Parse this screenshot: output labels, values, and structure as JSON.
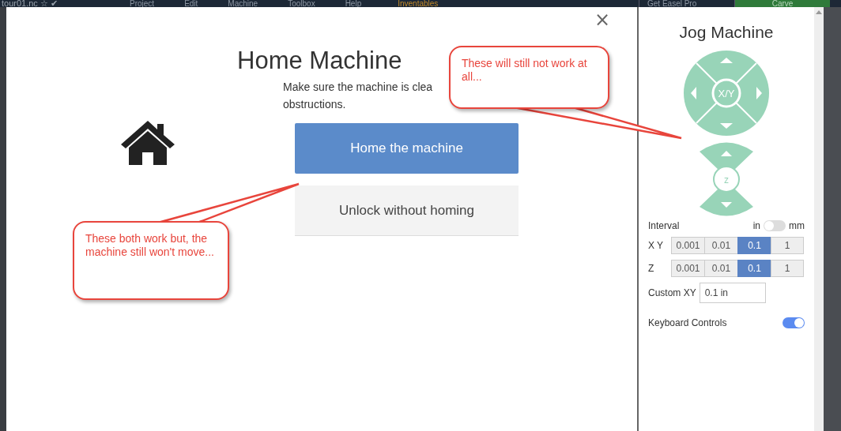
{
  "top_bar": {
    "file_name": "tour01.nc ☆ ✔",
    "menu": [
      "Project",
      "Edit",
      "Machine",
      "Toolbox",
      "Help"
    ],
    "brand": "Inventables",
    "pro_button": "Get Easel Pro",
    "carve_button": "Carve"
  },
  "modal": {
    "close": "×",
    "title": "Home Machine",
    "message_lines": [
      "Make sure the machine is clea",
      "obstructions."
    ],
    "buttons": [
      {
        "label": "Home the machine",
        "kind": "primary"
      },
      {
        "label": "Unlock without homing",
        "kind": "secondary"
      }
    ]
  },
  "jog_panel": {
    "title": "Jog Machine",
    "xy_label": "X/Y",
    "z_label": "z",
    "interval": {
      "label": "Interval",
      "unit_left": "in",
      "unit_right": "mm",
      "on": false
    },
    "rows": [
      {
        "label": "X Y",
        "options": [
          {
            "label": "0.001",
            "selected": false
          },
          {
            "label": "0.01",
            "selected": false
          },
          {
            "label": "0.1",
            "selected": true
          },
          {
            "label": "1",
            "selected": false
          }
        ]
      },
      {
        "label": "Z",
        "options": [
          {
            "label": "0.001",
            "selected": false
          },
          {
            "label": "0.01",
            "selected": false
          },
          {
            "label": "0.1",
            "selected": true
          },
          {
            "label": "1",
            "selected": false
          }
        ]
      }
    ],
    "custom": {
      "label": "Custom XY",
      "value": "0.1 in"
    },
    "keyboard": {
      "label": "Keyboard Controls",
      "on": true
    }
  },
  "callouts": [
    {
      "text": "These will still not work at all..."
    },
    {
      "text": "These both work but, the machine still won't move..."
    }
  ]
}
